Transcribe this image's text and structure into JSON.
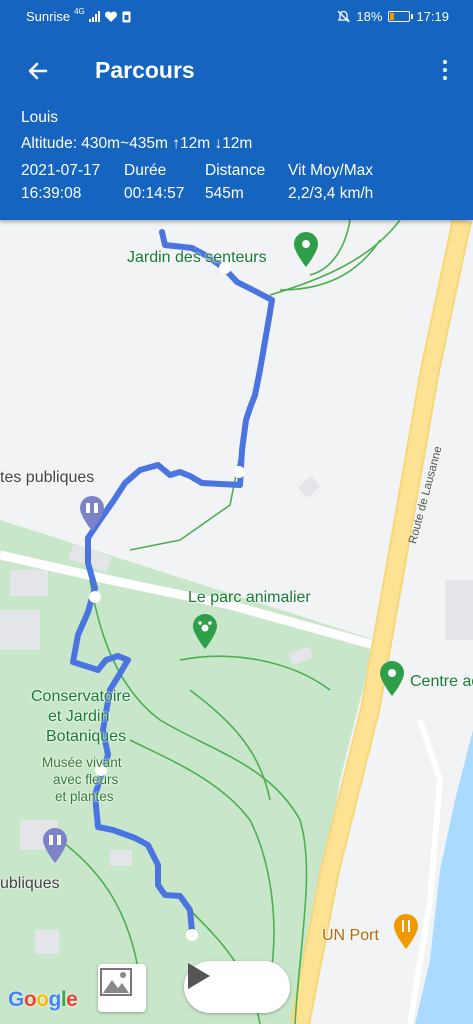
{
  "status_bar": {
    "carrier": "Sunrise",
    "network": "4G",
    "battery": "18%",
    "time": "17:19"
  },
  "app_bar": {
    "title": "Parcours",
    "back_icon": "arrow-left-icon",
    "menu_icon": "more-vert-icon"
  },
  "track": {
    "user": "Louis",
    "altitude": "Altitude: 430m~435m ↑12m ↓12m",
    "stats": [
      {
        "label": "2021-07-17",
        "value": "16:39:08"
      },
      {
        "label": "Durée",
        "value": "00:14:57"
      },
      {
        "label": "Distance",
        "value": "545m"
      },
      {
        "label": "Vit Moy/Max",
        "value": "2,2/3,4 km/h"
      }
    ]
  },
  "map": {
    "labels": {
      "jardin_senteurs": "Jardin des senteurs",
      "toilettes_top": "tes publiques",
      "parc_animalier": "Le parc animalier",
      "conservatoire": "Conservatoire",
      "conservatoire_2": "et Jardin",
      "conservatoire_3": "Botaniques",
      "musee": "Musée vivant",
      "musee_2": "avec fleurs",
      "musee_3": "et plantes",
      "toilettes_bottom": "ubliques",
      "centre": "Centre aq",
      "un_port": "UN Port",
      "route": "Route de Lausanne",
      "google": "Google"
    },
    "colors": {
      "route_line": "#4a74e0",
      "green_area": "#c8e6c9",
      "road": "#fde293",
      "water": "#aadaff",
      "header": "#1565c0"
    }
  },
  "controls": {
    "photo_icon": "image-icon",
    "play_icon": "play-icon"
  }
}
